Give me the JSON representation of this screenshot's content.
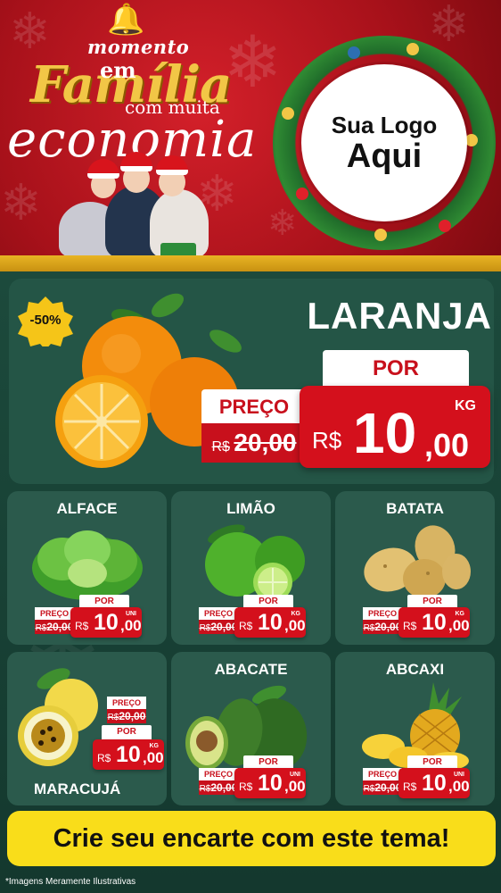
{
  "header": {
    "line1": "momento",
    "line2": "em",
    "line3": "Família",
    "line4": "com muita",
    "line5": "economia",
    "logo_line1": "Sua Logo",
    "logo_line2": "Aqui"
  },
  "hero": {
    "discount": "-50%",
    "name": "LARANJA",
    "por_label": "POR",
    "preco_label": "PREÇO",
    "old_currency": "R$",
    "old_price": "20,00",
    "unit": "KG",
    "currency": "R$",
    "price_int": "10",
    "price_dec": ",00"
  },
  "products": [
    {
      "name": "ALFACE",
      "preco_label": "PREÇO",
      "old_currency": "R$",
      "old_price": "20,00",
      "por_label": "POR",
      "unit": "UNI",
      "currency": "R$",
      "price_int": "10",
      "price_dec": ",00"
    },
    {
      "name": "LIMÃO",
      "preco_label": "PREÇO",
      "old_currency": "R$",
      "old_price": "20,00",
      "por_label": "POR",
      "unit": "KG",
      "currency": "R$",
      "price_int": "10",
      "price_dec": ",00"
    },
    {
      "name": "BATATA",
      "preco_label": "PREÇO",
      "old_currency": "R$",
      "old_price": "20,00",
      "por_label": "POR",
      "unit": "KG",
      "currency": "R$",
      "price_int": "10",
      "price_dec": ",00"
    },
    {
      "name": "MARACUJÁ",
      "preco_label": "PREÇO",
      "old_currency": "R$",
      "old_price": "20,00",
      "por_label": "POR",
      "unit": "KG",
      "currency": "R$",
      "price_int": "10",
      "price_dec": ",00"
    },
    {
      "name": "ABACATE",
      "preco_label": "PREÇO",
      "old_currency": "R$",
      "old_price": "20,00",
      "por_label": "POR",
      "unit": "UNI",
      "currency": "R$",
      "price_int": "10",
      "price_dec": ",00"
    },
    {
      "name": "ABCAXI",
      "preco_label": "PREÇO",
      "old_currency": "R$",
      "old_price": "20,00",
      "por_label": "POR",
      "unit": "UNI",
      "currency": "R$",
      "price_int": "10",
      "price_dec": ",00"
    }
  ],
  "cta": "Crie seu encarte com este tema!",
  "disclaimer": "*Imagens Meramente Ilustrativas",
  "colors": {
    "header_red": "#c8101c",
    "gold": "#f2c646",
    "background_green": "#1c4a3c",
    "price_red": "#d4101c",
    "cta_yellow": "#f9dd1a"
  }
}
